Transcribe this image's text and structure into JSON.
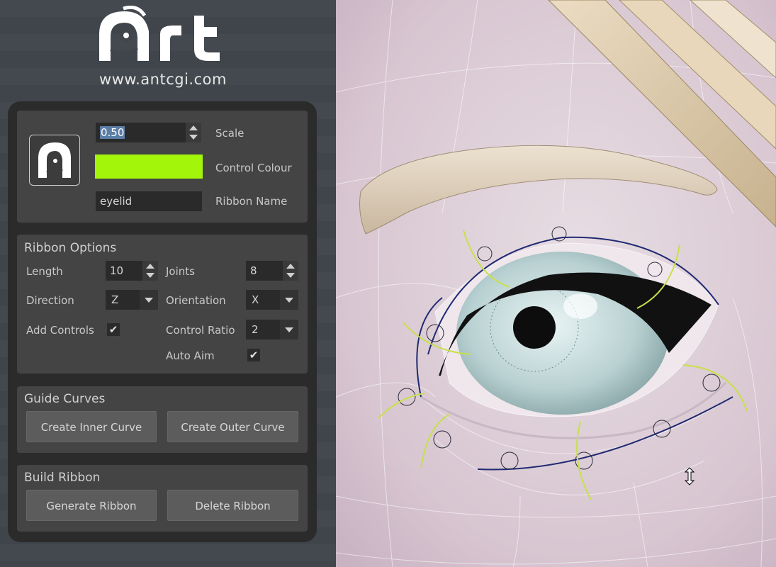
{
  "branding": {
    "logo_text": "Art",
    "url": "www.antcgi.com"
  },
  "header": {
    "scale_value": "0.50",
    "scale_label": "Scale",
    "control_colour_label": "Control Colour",
    "control_colour": "#a3f50a",
    "ribbon_name_value": "eyelid",
    "ribbon_name_label": "Ribbon Name"
  },
  "ribbon_options": {
    "title": "Ribbon Options",
    "length_label": "Length",
    "length_value": "10",
    "joints_label": "Joints",
    "joints_value": "8",
    "direction_label": "Direction",
    "direction_value": "Z",
    "orientation_label": "Orientation",
    "orientation_value": "X",
    "add_controls_label": "Add Controls",
    "add_controls_checked": "✔",
    "control_ratio_label": "Control Ratio",
    "control_ratio_value": "2",
    "auto_aim_label": "Auto Aim",
    "auto_aim_checked": "✔"
  },
  "guide_curves": {
    "title": "Guide Curves",
    "create_inner_label": "Create Inner Curve",
    "create_outer_label": "Create Outer Curve"
  },
  "build_ribbon": {
    "title": "Build Ribbon",
    "generate_label": "Generate Ribbon",
    "delete_label": "Delete Ribbon"
  },
  "viewport": {
    "cursor_icon": "resize-vertical-icon"
  }
}
